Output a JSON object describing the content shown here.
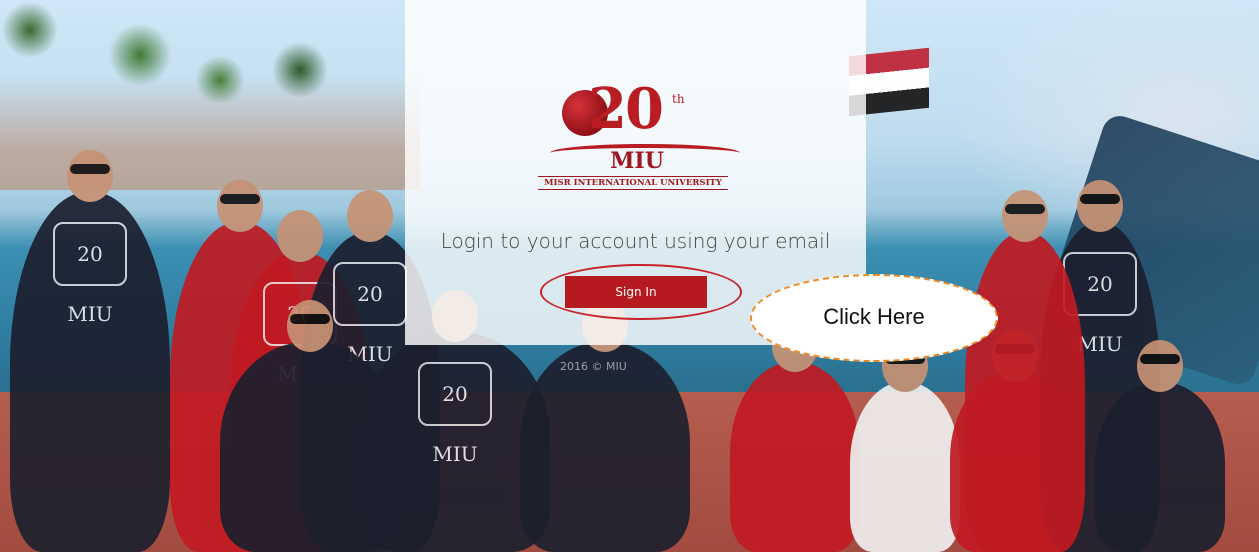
{
  "logo": {
    "anniversary_number": "20",
    "anniversary_suffix": "th",
    "short_name": "MIU",
    "full_name": "MISR INTERNATIONAL UNIVERSITY"
  },
  "login": {
    "heading": "Login to your account using your email",
    "signin_label": "Sign In"
  },
  "annotation": {
    "callout_text": "Click Here",
    "accent_color": "#f08a24",
    "highlight_color": "#c9232a"
  },
  "footer": {
    "copyright": "2016 © MIU"
  },
  "colors": {
    "button": "#b61a1f",
    "brand_red": "#b81d24"
  },
  "background": {
    "hoodie_prints": [
      "20 MIU",
      "20 MIU",
      "20 MIU",
      "20 MIU",
      "20 MIU"
    ]
  }
}
